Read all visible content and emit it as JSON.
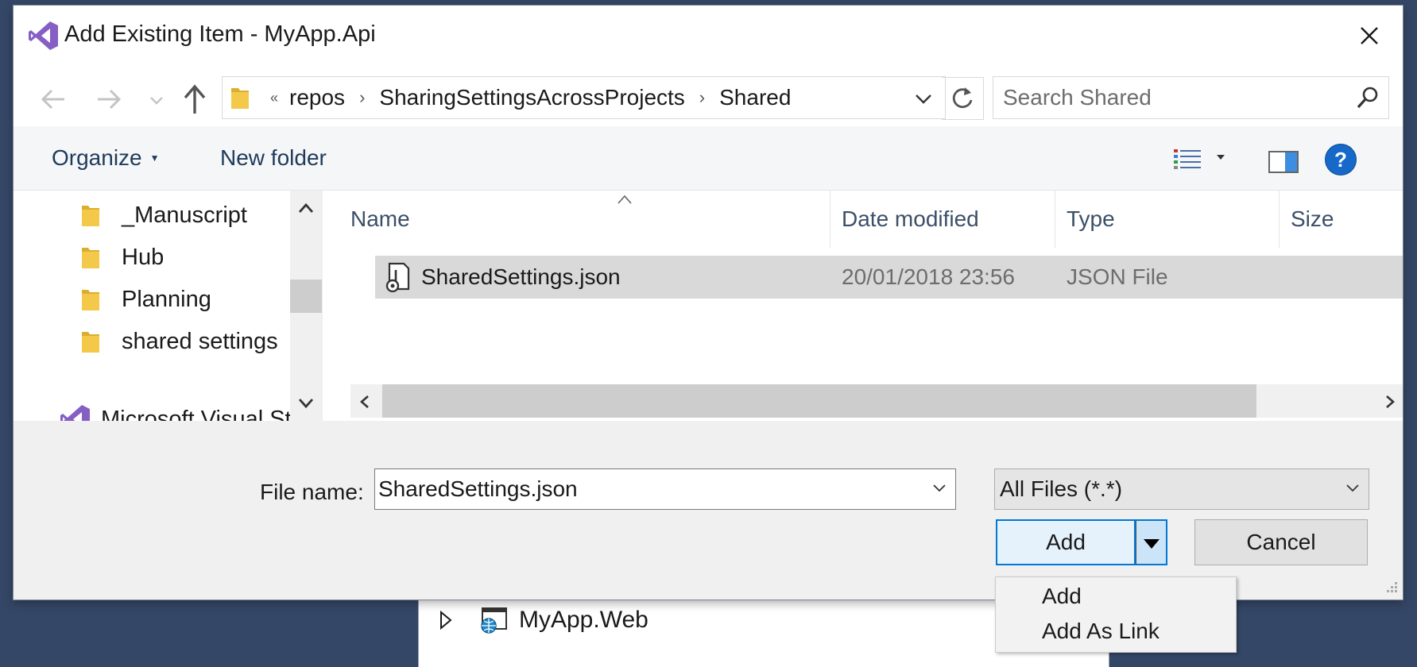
{
  "window": {
    "title": "Add Existing Item - MyApp.Api"
  },
  "address": {
    "overflow": "«",
    "crumbs": [
      "repos",
      "SharingSettingsAcrossProjects",
      "Shared"
    ],
    "separator": "›"
  },
  "search": {
    "placeholder": "Search Shared"
  },
  "toolbar": {
    "organize_label": "Organize",
    "new_folder_label": "New folder",
    "help_label": "?"
  },
  "nav": {
    "items": [
      {
        "label": "_Manuscript",
        "icon": "folder-icon"
      },
      {
        "label": "Hub",
        "icon": "folder-icon"
      },
      {
        "label": "Planning",
        "icon": "folder-icon"
      },
      {
        "label": "shared settings",
        "icon": "folder-icon"
      }
    ],
    "partial_item": "Microsoft Visual St"
  },
  "file_list": {
    "columns": [
      "Name",
      "Date modified",
      "Type",
      "Size"
    ],
    "rows": [
      {
        "name": "SharedSettings.json",
        "date": "20/01/2018 23:56",
        "type": "JSON File",
        "size": "",
        "icon": "json-file-icon",
        "selected": true
      }
    ]
  },
  "bottom": {
    "file_name_label": "File name:",
    "file_name_value": "SharedSettings.json",
    "file_type": "All Files (*.*)",
    "add_label": "Add",
    "cancel_label": "Cancel"
  },
  "add_menu": {
    "items": [
      "Add",
      "Add As Link"
    ]
  },
  "background": {
    "project_label": "MyApp.Web"
  },
  "colors": {
    "accent": "#0078d7",
    "vs_purple": "#865fc5",
    "help_blue": "#1669c8",
    "folder_yellow": "#f4c94a",
    "backdrop": "#354766"
  }
}
